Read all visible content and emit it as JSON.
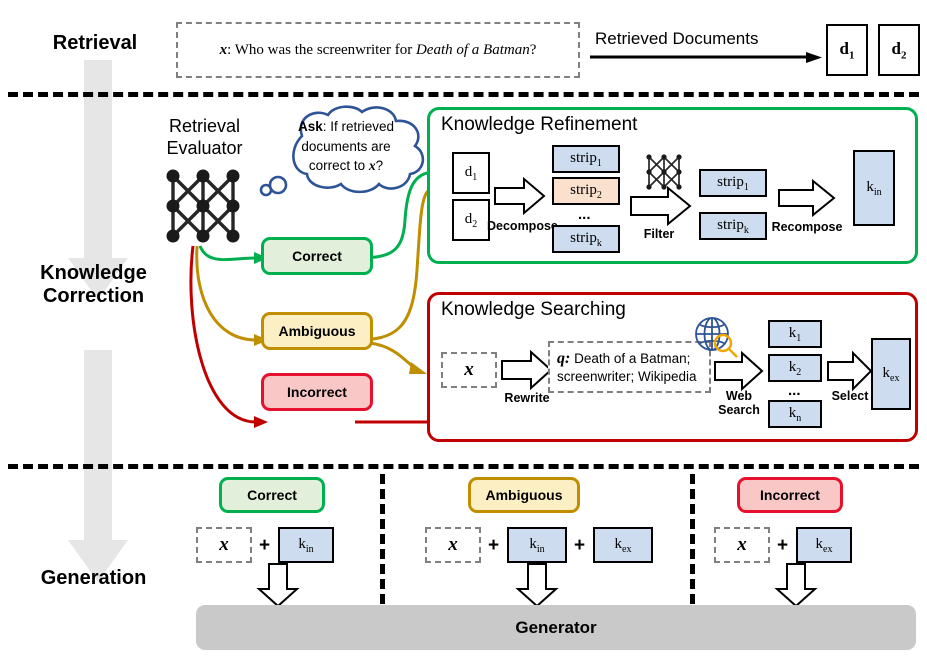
{
  "stages": {
    "retrieval": "Retrieval",
    "correction_line1": "Knowledge",
    "correction_line2": "Correction",
    "generation": "Generation"
  },
  "retrieval": {
    "query_prefix": "x",
    "query_sep": ": Who was the screenwriter for ",
    "query_italic": "Death of a Batman",
    "query_suffix": "?",
    "arrow_label": "Retrieved Documents",
    "documents": [
      {
        "base": "d",
        "sub": "1"
      },
      {
        "base": "d",
        "sub": "2"
      }
    ]
  },
  "evaluator": {
    "title_line1": "Retrieval",
    "title_line2": "Evaluator",
    "bubble_bold": "Ask",
    "bubble_text_1": ": If retrieved",
    "bubble_text_2": "documents are",
    "bubble_text_3a": "correct to ",
    "bubble_text_3b": "x",
    "bubble_text_3c": "?",
    "bubble_color": "#2E5496"
  },
  "labels": {
    "correct": "Correct",
    "ambiguous": "Ambiguous",
    "incorrect": "Incorrect"
  },
  "refinement": {
    "title": "Knowledge Refinement",
    "docs": [
      {
        "base": "d",
        "sub": "1"
      },
      {
        "base": "d",
        "sub": "2"
      }
    ],
    "step1": "Decompose",
    "strips_in": [
      {
        "base": "strip",
        "sub": "1",
        "fill": "blue"
      },
      {
        "base": "strip",
        "sub": "2",
        "fill": "peach"
      },
      {
        "base": "strip",
        "sub": "k",
        "fill": "blue"
      }
    ],
    "ellipsis": "...",
    "step2": "Filter",
    "strips_out": [
      {
        "base": "strip",
        "sub": "1"
      },
      {
        "base": "strip",
        "sub": "k"
      }
    ],
    "step3": "Recompose",
    "output": {
      "base": "k",
      "sub": "in"
    }
  },
  "searching": {
    "title": "Knowledge Searching",
    "input_var": "x",
    "step1": "Rewrite",
    "query_prefix": "q:",
    "query_line1": " Death of a Batman;",
    "query_line2": "screenwriter; Wikipedia",
    "step2_line1": "Web",
    "step2_line2": "Search",
    "results": [
      {
        "base": "k",
        "sub": "1"
      },
      {
        "base": "k",
        "sub": "2"
      },
      {
        "base": "k",
        "sub": "n"
      }
    ],
    "ellipsis": "...",
    "step3": "Select",
    "output": {
      "base": "k",
      "sub": "ex"
    }
  },
  "generation": {
    "columns": [
      {
        "pill": "Correct",
        "pill_kind": "correct",
        "input_var": "x",
        "plus": "+",
        "items": [
          {
            "base": "k",
            "sub": "in"
          }
        ]
      },
      {
        "pill": "Ambiguous",
        "pill_kind": "ambiguous",
        "input_var": "x",
        "plus": "+",
        "items": [
          {
            "base": "k",
            "sub": "in"
          },
          {
            "base": "k",
            "sub": "ex"
          }
        ]
      },
      {
        "pill": "Incorrect",
        "pill_kind": "incorrect",
        "input_var": "x",
        "plus": "+",
        "items": [
          {
            "base": "k",
            "sub": "ex"
          }
        ]
      }
    ],
    "generator": "Generator"
  },
  "colors": {
    "green": "#00B050",
    "gold": "#BF8F00",
    "red": "#C00000",
    "grey_arrow": "#E6E6E6",
    "generator_bar": "#C9C9C9",
    "box_blue": "#CEDCEF",
    "box_peach": "#FBE1CD",
    "globe_blue": "#2E5496",
    "magnifier_orange": "#F0A500"
  }
}
